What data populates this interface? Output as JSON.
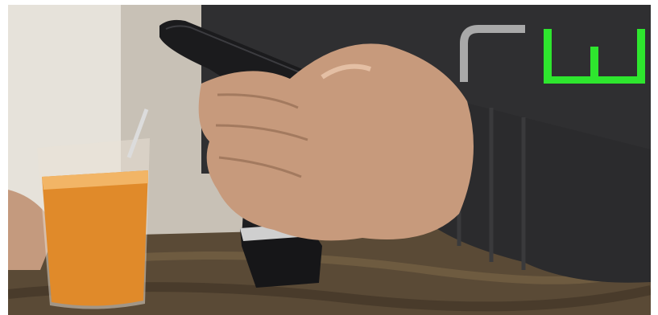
{
  "image": {
    "logo": {
      "letters": "rw",
      "colors": {
        "r": "#a9a9a9",
        "w": "#2ee62e"
      }
    },
    "colors": {
      "sweater": "#2b2b2d",
      "phone": "#1b1b1d",
      "juice": "#e08a2a",
      "table": "#5a4a36",
      "skin": "#c79a7c"
    }
  }
}
